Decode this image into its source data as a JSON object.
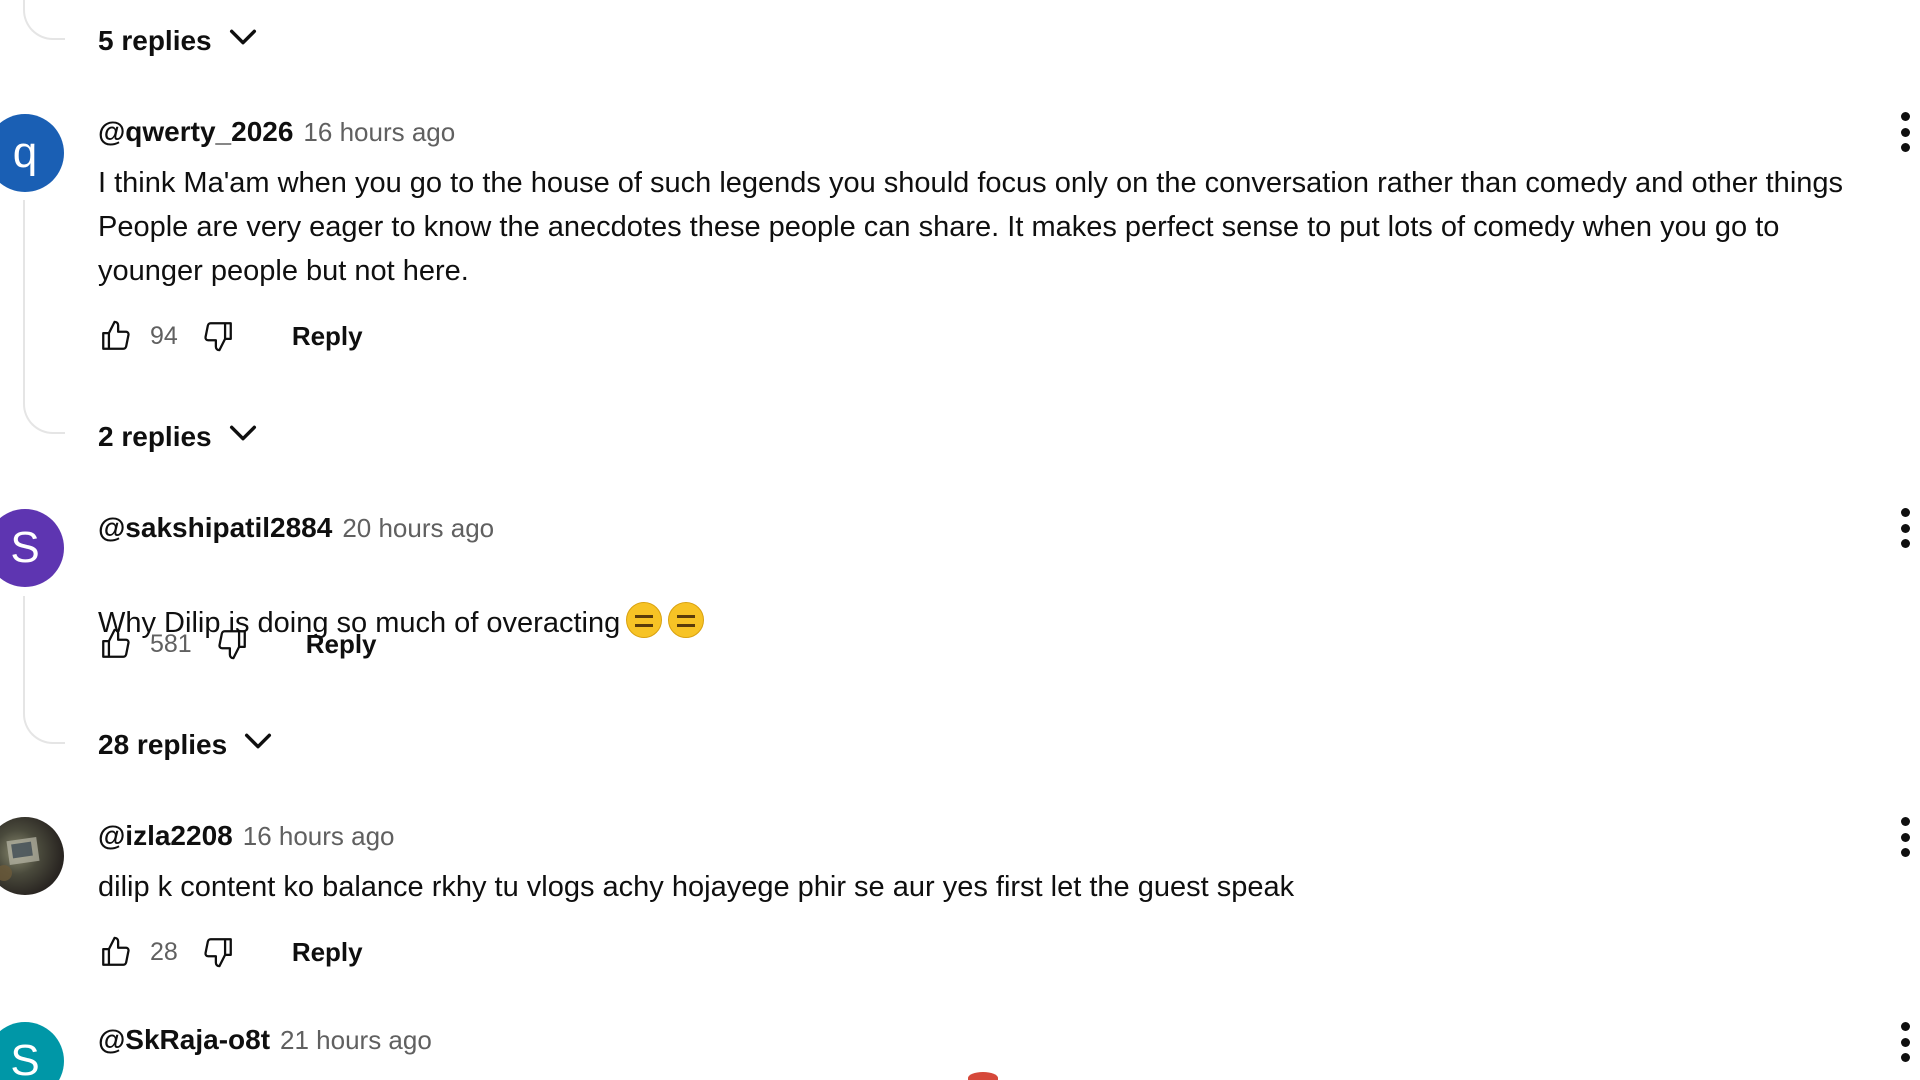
{
  "threads": [
    {
      "replies_label": "5 replies"
    },
    {
      "avatar_letter": "q",
      "avatar_color": "#1a5fb4",
      "handle": "@qwerty_2026",
      "time": "16 hours ago",
      "text": "I think Ma'am when you go to the house of such legends you should focus only on the conversation rather than comedy and other things\nPeople are very eager to know the anecdotes these people can share. It makes perfect sense to put lots of comedy when you go to\nyounger people but not here.",
      "likes": "94",
      "reply_label": "Reply",
      "replies_label": "2 replies"
    },
    {
      "avatar_letter": "S",
      "avatar_color": "#5e35b1",
      "handle": "@sakshipatil2884",
      "time": "20 hours ago",
      "text": "Why Dilip is doing so much of overacting",
      "emoji_icon": "expressionless-face-icon",
      "likes": "581",
      "reply_label": "Reply",
      "replies_label": "28 replies"
    },
    {
      "avatar_letter": "",
      "handle": "@izla2208",
      "time": "16 hours ago",
      "text": "dilip k content ko balance rkhy tu vlogs achy hojayege phir se aur yes first let the guest speak",
      "likes": "28",
      "reply_label": "Reply"
    },
    {
      "avatar_letter": "S",
      "avatar_color": "#0097a7",
      "handle": "@SkRaja-o8t",
      "time": "21 hours ago"
    }
  ],
  "icons": {
    "like": "thumbs-up-icon",
    "dislike": "thumbs-down-icon",
    "expand": "chevron-down-icon",
    "more": "more-vertical-icon"
  },
  "colors": {
    "text_primary": "#0f0f0f",
    "text_secondary": "#606060",
    "thread_line": "#e5e5e5"
  }
}
